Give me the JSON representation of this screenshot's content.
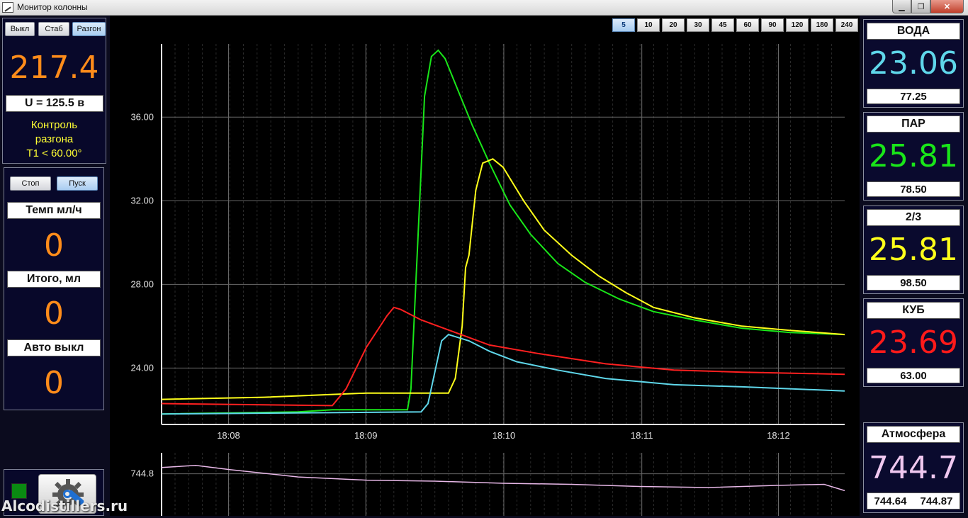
{
  "window": {
    "title": "Монитор колонны",
    "min": "▁",
    "max": "❐",
    "close": "✕"
  },
  "left": {
    "mode_buttons": [
      "Выкл",
      "Стаб",
      "Разгон"
    ],
    "main_value": "217.4",
    "voltage": "U = 125.5 в",
    "control_text": [
      "Контроль",
      "разгона",
      "T1 < 60.00°"
    ],
    "stop_label": "Стоп",
    "start_label": "Пуск",
    "rate_label": "Темп мл/ч",
    "rate_value": "0",
    "total_label": "Итого, мл",
    "total_value": "0",
    "auto_label": "Авто выкл",
    "auto_value": "0",
    "settings_icon": "gear-wrench-icon",
    "status_color": "#0a8a12"
  },
  "range_buttons": [
    "5",
    "10",
    "20",
    "30",
    "45",
    "60",
    "90",
    "120",
    "180",
    "240"
  ],
  "range_active": "5",
  "right": {
    "cards": [
      {
        "title": "ВОДА",
        "value": "23.06",
        "sub": "77.25",
        "color": "#5fd7ea"
      },
      {
        "title": "ПАР",
        "value": "25.81",
        "sub": "78.50",
        "color": "#19e619"
      },
      {
        "title": "2/3",
        "value": "25.81",
        "sub": "98.50",
        "color": "#ffff1a"
      },
      {
        "title": "КУБ",
        "value": "23.69",
        "sub": "63.00",
        "color": "#ff1a1a"
      }
    ],
    "atm": {
      "title": "Атмосфера",
      "value": "744.7",
      "min": "744.64",
      "max": "744.87",
      "color": "#f0c8f0"
    }
  },
  "watermark": "Alcodistillers.ru",
  "chart_data": {
    "type": "line",
    "x_ticks": [
      "18:08",
      "18:09",
      "18:10",
      "18:11",
      "18:12"
    ],
    "y_ticks": [
      24.0,
      28.0,
      32.0,
      36.0
    ],
    "y_tick_labels": [
      "24.00",
      "28.00",
      "32.00",
      "36.00"
    ],
    "ylim": [
      21.3,
      39.5
    ],
    "xlim": [
      0,
      100
    ],
    "series": [
      {
        "color": "#19e619",
        "points": [
          [
            0,
            21.8
          ],
          [
            20,
            21.9
          ],
          [
            25,
            22.0
          ],
          [
            36,
            22.0
          ],
          [
            36.5,
            23
          ],
          [
            37.5,
            30
          ],
          [
            38.5,
            37
          ],
          [
            39.5,
            38.9
          ],
          [
            40.5,
            39.2
          ],
          [
            41.5,
            38.8
          ],
          [
            43.5,
            37.2
          ],
          [
            45.5,
            35.6
          ],
          [
            48,
            33.8
          ],
          [
            51,
            31.8
          ],
          [
            54,
            30.4
          ],
          [
            58,
            29.0
          ],
          [
            62,
            28.1
          ],
          [
            67,
            27.3
          ],
          [
            72,
            26.7
          ],
          [
            78,
            26.3
          ],
          [
            85,
            25.9
          ],
          [
            92,
            25.7
          ],
          [
            100,
            25.6
          ]
        ]
      },
      {
        "color": "#ffff1a",
        "points": [
          [
            0,
            22.5
          ],
          [
            15,
            22.6
          ],
          [
            30,
            22.8
          ],
          [
            42,
            22.8
          ],
          [
            43,
            23.5
          ],
          [
            44,
            26
          ],
          [
            44.5,
            28.8
          ],
          [
            45,
            29.4
          ],
          [
            46,
            32.5
          ],
          [
            47,
            33.8
          ],
          [
            48.5,
            34.0
          ],
          [
            50,
            33.6
          ],
          [
            53,
            32.0
          ],
          [
            56,
            30.6
          ],
          [
            60,
            29.4
          ],
          [
            64,
            28.4
          ],
          [
            68,
            27.6
          ],
          [
            72,
            26.9
          ],
          [
            78,
            26.4
          ],
          [
            85,
            26.0
          ],
          [
            92,
            25.8
          ],
          [
            100,
            25.6
          ]
        ]
      },
      {
        "color": "#ff2020",
        "points": [
          [
            0,
            22.3
          ],
          [
            25,
            22.2
          ],
          [
            27,
            23.0
          ],
          [
            30,
            25.0
          ],
          [
            33,
            26.5
          ],
          [
            34,
            26.9
          ],
          [
            35,
            26.8
          ],
          [
            38,
            26.3
          ],
          [
            43,
            25.7
          ],
          [
            48,
            25.1
          ],
          [
            55,
            24.7
          ],
          [
            65,
            24.2
          ],
          [
            75,
            23.9
          ],
          [
            85,
            23.8
          ],
          [
            100,
            23.7
          ]
        ]
      },
      {
        "color": "#5fd7ea",
        "points": [
          [
            0,
            21.8
          ],
          [
            38,
            21.9
          ],
          [
            39,
            22.3
          ],
          [
            40,
            23.8
          ],
          [
            41,
            25.3
          ],
          [
            42,
            25.6
          ],
          [
            45,
            25.3
          ],
          [
            48,
            24.8
          ],
          [
            52,
            24.3
          ],
          [
            58,
            23.9
          ],
          [
            65,
            23.5
          ],
          [
            75,
            23.2
          ],
          [
            85,
            23.1
          ],
          [
            100,
            22.9
          ]
        ]
      }
    ]
  },
  "pressure_data": {
    "type": "line",
    "y_tick_labels": [
      "744.8"
    ],
    "ylim": [
      744.4,
      745.0
    ],
    "series": [
      {
        "color": "#e8b8e8",
        "points": [
          [
            0,
            744.86
          ],
          [
            5,
            744.88
          ],
          [
            10,
            744.84
          ],
          [
            20,
            744.77
          ],
          [
            30,
            744.74
          ],
          [
            40,
            744.73
          ],
          [
            50,
            744.71
          ],
          [
            60,
            744.7
          ],
          [
            70,
            744.68
          ],
          [
            80,
            744.67
          ],
          [
            90,
            744.69
          ],
          [
            97,
            744.7
          ],
          [
            100,
            744.64
          ]
        ]
      }
    ]
  }
}
